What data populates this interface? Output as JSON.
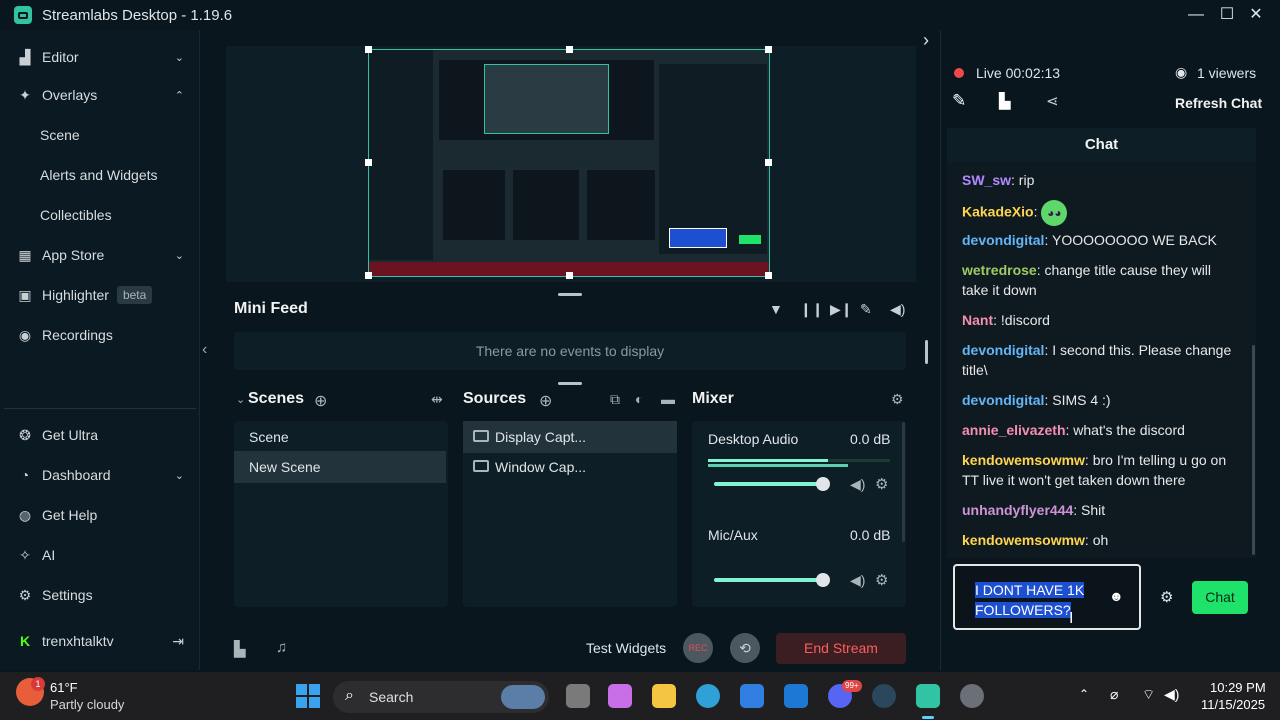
{
  "window": {
    "title": "Streamlabs Desktop - 1.19.6",
    "minimize": "—",
    "maximize": "☐",
    "close": "✕"
  },
  "sidebar": {
    "items": [
      {
        "label": "Editor"
      },
      {
        "label": "Overlays"
      },
      {
        "label": "Scene"
      },
      {
        "label": "Alerts and Widgets"
      },
      {
        "label": "Collectibles"
      },
      {
        "label": "App Store"
      },
      {
        "label": "Highlighter",
        "badge": "beta"
      },
      {
        "label": "Recordings"
      },
      {
        "label": "Get Ultra"
      },
      {
        "label": "Dashboard"
      },
      {
        "label": "Get Help"
      },
      {
        "label": "AI"
      },
      {
        "label": "Settings"
      },
      {
        "label": "trenxhtalktv"
      }
    ]
  },
  "minifeed": {
    "title": "Mini Feed",
    "empty": "There are no events to display"
  },
  "scenes": {
    "title": "Scenes",
    "items": [
      "Scene",
      "New Scene"
    ]
  },
  "sources": {
    "title": "Sources",
    "items": [
      "Display Capt...",
      "Window Cap..."
    ]
  },
  "mixer": {
    "title": "Mixer",
    "channels": [
      {
        "name": "Desktop Audio",
        "db": "0.0 dB"
      },
      {
        "name": "Mic/Aux",
        "db": "0.0 dB"
      }
    ]
  },
  "bottom": {
    "test_widgets": "Test Widgets",
    "rec": "REC",
    "end_stream": "End Stream"
  },
  "stream": {
    "live_label": "Live",
    "time": "00:02:13",
    "viewers": "1 viewers",
    "refresh": "Refresh Chat"
  },
  "chat": {
    "title": "Chat",
    "messages": [
      {
        "user": "SW_sw",
        "text": "rip",
        "color": "#b388ff"
      },
      {
        "user": "KakadeXio",
        "text": "",
        "color": "#ffd54f"
      },
      {
        "user": "devondigital",
        "text": "YOOOOOOOO WE BACK",
        "color": "#64b5f6"
      },
      {
        "user": "wetredrose",
        "text": "change title cause they will take it down",
        "color": "#9ccc65"
      },
      {
        "user": "Nant",
        "text": "!discord",
        "color": "#f48fb1"
      },
      {
        "user": "devondigital",
        "text": "I second this. Please change title\\",
        "color": "#64b5f6"
      },
      {
        "user": "devondigital",
        "text": "SIMS 4 :)",
        "color": "#64b5f6"
      },
      {
        "user": "annie_elivazeth",
        "text": "what's the discord",
        "color": "#f48fb1"
      },
      {
        "user": "kendowemsowmw",
        "text": "bro I'm telling u go on TT live it won't get taken down there",
        "color": "#ffd54f"
      },
      {
        "user": "unhandyflyer444",
        "text": "Shit",
        "color": "#ce93d8"
      },
      {
        "user": "kendowemsowmw",
        "text": "oh",
        "color": "#ffd54f"
      }
    ],
    "input_value": "I DONT HAVE 1K FOLLOWERS?",
    "send": "Chat"
  },
  "taskbar": {
    "weather_temp": "61°F",
    "weather_desc": "Partly cloudy",
    "weather_badge": "1",
    "search": "Search",
    "notif_badge": "99+",
    "time": "10:29 PM",
    "date": "11/15/2025"
  }
}
